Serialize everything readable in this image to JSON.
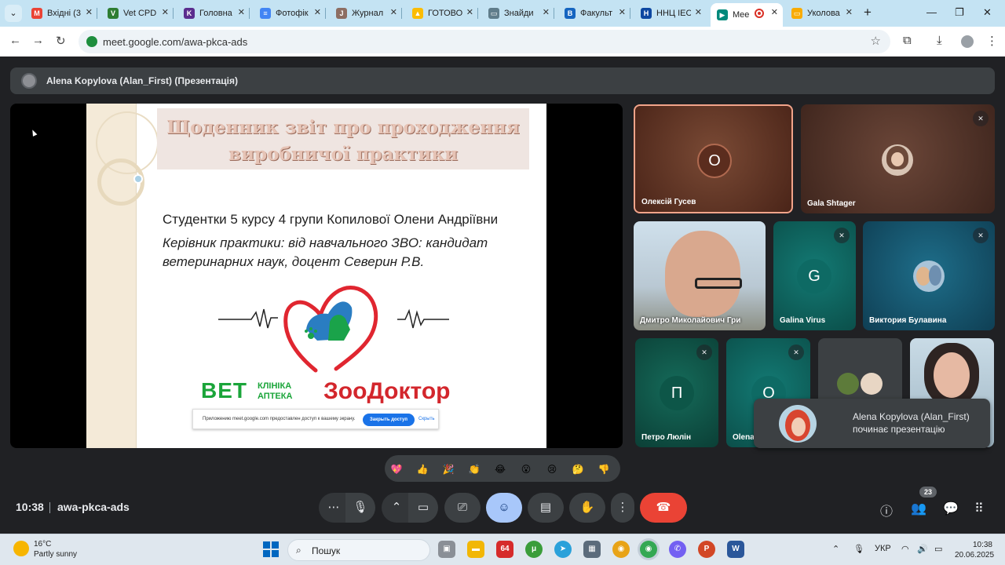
{
  "browser": {
    "tabs": [
      {
        "label": "Вхідні (3",
        "color": "#ea4335",
        "icon": "gmail-icon"
      },
      {
        "label": "Vet CPD",
        "color": "#2e7d32",
        "icon": "vet-cpd-icon"
      },
      {
        "label": "Головна",
        "color": "#5b2d8e",
        "icon": "site-icon"
      },
      {
        "label": "Фотофік",
        "color": "#4285f4",
        "icon": "docs-icon"
      },
      {
        "label": "Журнал",
        "color": "#8d6e63",
        "icon": "journal-icon"
      },
      {
        "label": "ГОТОВО",
        "color": "#fbbc04",
        "icon": "drive-icon"
      },
      {
        "label": "Знайди",
        "color": "#607d8b",
        "icon": "search-site-icon"
      },
      {
        "label": "Факульт",
        "color": "#1565c0",
        "icon": "faculty-icon"
      },
      {
        "label": "ННЦ ІЕС",
        "color": "#0d47a1",
        "icon": "institute-icon"
      },
      {
        "label": "Mee",
        "color": "#00897b",
        "icon": "meet-icon"
      },
      {
        "label": "Уколова",
        "color": "#f9ab00",
        "icon": "slides-icon"
      }
    ],
    "url": "meet.google.com/awa-pkca-ads"
  },
  "presentation": {
    "presenter_title": "Alena Kopylova (Alan_First) (Презентація)",
    "slide": {
      "title": "Щоденник звіт про проходження\nвиробничої практики",
      "student": "Студентки 5 курсу 4 групи Копилової Олени Андріївни",
      "supervisor": "Керівник практики: від навчального ЗВО: кандидат ветеринарних наук, доцент Северин Р.В.",
      "brand_vet": "ВЕТ",
      "brand_clinic": "КЛІНІКА\nАПТЕКА",
      "brand_zoo": "ЗооДоктор"
    },
    "share_bar": {
      "message": "Приложению meet.google.com предоставлен доступ к вашему экрану.",
      "stop": "Закрыть доступ",
      "hide": "Скрыть"
    }
  },
  "participants": [
    {
      "name": "Олексій Гусев",
      "letter": "О"
    },
    {
      "name": "Gala Shtager"
    },
    {
      "name": "Дмитро Миколайович Гри"
    },
    {
      "name": "Galina Virus",
      "letter": "G"
    },
    {
      "name": "Виктория Булавина"
    },
    {
      "name": "Петро Люлін",
      "letter": "П"
    },
    {
      "name": "Olena",
      "letter": "O"
    }
  ],
  "notification": {
    "text": "Alena Kopylova (Alan_First)\nпочинає презентацію"
  },
  "reactions": [
    "💖",
    "👍",
    "🎉",
    "👏",
    "😂",
    "😮",
    "😢",
    "🤔",
    "👎"
  ],
  "meeting": {
    "time": "10:38",
    "code": "awa-pkca-ads",
    "participant_count": "23"
  },
  "taskbar": {
    "temperature": "16°C",
    "weather": "Partly sunny",
    "search": "Пошук",
    "app_64": "64",
    "language": "УКР",
    "clock": "10:38\n20.06.2025"
  },
  "colors": {
    "meet_bg": "#202124",
    "end_call": "#ea4335",
    "accent": "#a8c7fa"
  }
}
